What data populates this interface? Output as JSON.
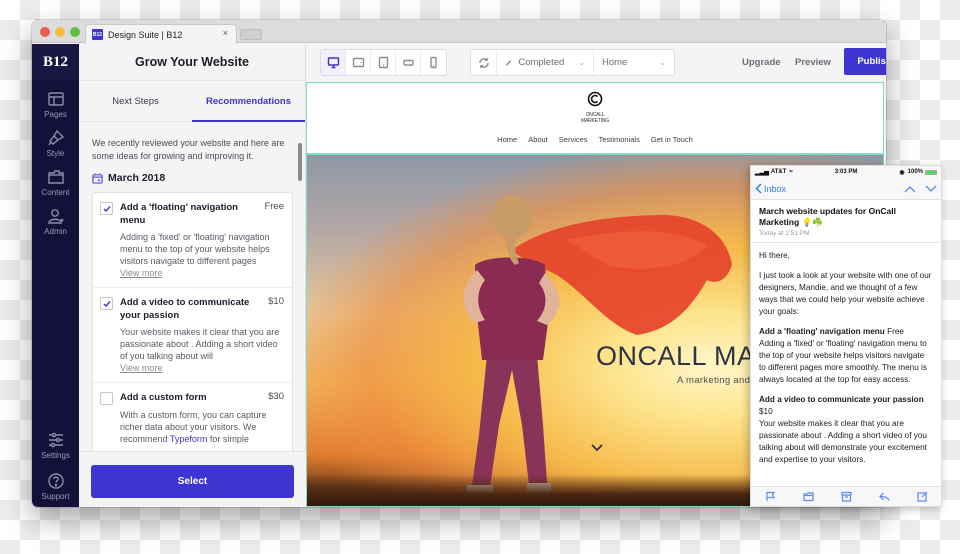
{
  "browser": {
    "tab_title": "Design Suite | B12",
    "favicon_text": "B12",
    "close_glyph": "×"
  },
  "rail": {
    "logo": "B12",
    "items": [
      {
        "label": "Pages",
        "icon": "layout-icon"
      },
      {
        "label": "Style",
        "icon": "brush-icon"
      },
      {
        "label": "Content",
        "icon": "folder-icon"
      },
      {
        "label": "Admin",
        "icon": "user-star-icon"
      }
    ],
    "bottom_items": [
      {
        "label": "Settings",
        "icon": "sliders-icon"
      },
      {
        "label": "Support",
        "icon": "help-icon"
      }
    ]
  },
  "panel": {
    "title": "Grow Your Website",
    "tabs": [
      {
        "label": "Next Steps",
        "active": false
      },
      {
        "label": "Recommendations",
        "active": true
      }
    ],
    "intro": "We recently reviewed your website and here are some ideas for growing and improving it.",
    "month": "March 2018",
    "recommendations": [
      {
        "title": "Add a 'floating' navigation menu",
        "price": "Free",
        "checked": true,
        "description": "Adding a 'fixed' or 'floating' navigation menu to the top of your website helps visitors navigate to different pages",
        "more": "View more"
      },
      {
        "title": "Add a video to communicate your passion",
        "price": "$10",
        "checked": true,
        "description": "Your website makes it clear that you are passionate about . Adding a short video of you talking about will",
        "more": "View more"
      },
      {
        "title": "Add a custom form",
        "price": "$30",
        "checked": false,
        "description_pre": "With a custom form, you can capture richer data about your visitors. We recommend ",
        "description_link": "Typeform",
        "description_post": " for simple"
      }
    ],
    "select_label": "Select"
  },
  "toolbar": {
    "devices": [
      {
        "name": "desktop",
        "active": true
      },
      {
        "name": "tablet-landscape",
        "active": false
      },
      {
        "name": "tablet-portrait",
        "active": false
      },
      {
        "name": "phone-landscape",
        "active": false
      },
      {
        "name": "phone-portrait",
        "active": false
      }
    ],
    "status_value": "Completed",
    "page_value": "Home",
    "upgrade_label": "Upgrade",
    "preview_label": "Preview",
    "publish_label": "Publish"
  },
  "site": {
    "logo_line1": "ONCALL",
    "logo_line2": "MARKETING",
    "nav": [
      "Home",
      "About",
      "Services",
      "Testimonials",
      "Get in Touch"
    ],
    "hero_title": "ONCALL MA",
    "hero_subtitle": "A marketing and"
  },
  "phone": {
    "carrier": "AT&T",
    "time": "3:03 PM",
    "battery": "100%",
    "back_label": "Inbox",
    "subject": "March website updates for OnCall Marketing 💡☘️",
    "date": "Today at 2:51 PM",
    "greeting": "Hi there,",
    "intro": "I just took a look at your website with one of our designers, Mandie, and we thought of a few ways that we could help your website achieve your goals:",
    "items": [
      {
        "title": "Add a 'floating' navigation menu",
        "price": "Free",
        "body": "Adding a 'fixed' or 'floating' navigation menu to the top of your website helps visitors navigate to different pages more smoothly. The menu is always located at the top for easy access."
      },
      {
        "title": "Add a video to communicate your passion",
        "price": "$10",
        "body": "Your website makes it clear that you are passionate about . Adding a short video of you talking about will demonstrate your excitement and expertise to your visitors."
      }
    ]
  },
  "colors": {
    "accent": "#3d34d1",
    "rail_bg": "#13113a",
    "preview_outline": "#7fdcc8",
    "ios_blue": "#2f7bf6"
  }
}
